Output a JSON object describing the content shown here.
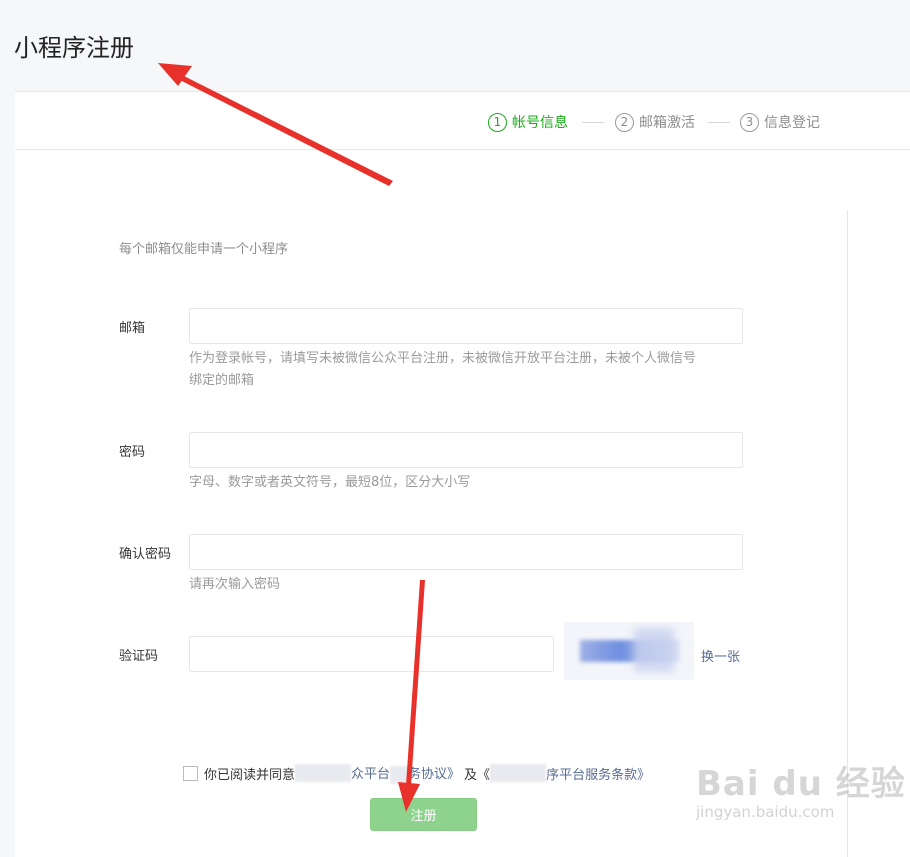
{
  "page": {
    "title": "小程序注册"
  },
  "steps": [
    {
      "num": "1",
      "label": "帐号信息",
      "active": true
    },
    {
      "num": "2",
      "label": "邮箱激活",
      "active": false
    },
    {
      "num": "3",
      "label": "信息登记",
      "active": false
    }
  ],
  "form": {
    "tip": "每个邮箱仅能申请一个小程序",
    "email": {
      "label": "邮箱",
      "value": "",
      "hint_line1": "作为登录帐号，请填写未被微信公众平台注册，未被微信开放平台注册，未被个人微信号",
      "hint_line2": "绑定的邮箱"
    },
    "password": {
      "label": "密码",
      "value": "",
      "hint": "字母、数字或者英文符号，最短8位，区分大小写"
    },
    "confirm": {
      "label": "确认密码",
      "value": "",
      "hint": "请再次输入密码"
    },
    "captcha": {
      "label": "验证码",
      "value": "",
      "refresh": "换一张"
    }
  },
  "agreement": {
    "prefix": "你已阅读并同意",
    "link1_suffix": "众平台",
    "link1_end": "务协议》",
    "and": "及《",
    "link2": "序平台服务条款》"
  },
  "submit_label": "注册",
  "watermark": {
    "logo": "Bai du 经验",
    "url": "jingyan.baidu.com"
  },
  "colors": {
    "accent": "#1aad19",
    "link": "#576b95",
    "arrow": "#e8312a",
    "button_disabled": "#8ed38d"
  }
}
